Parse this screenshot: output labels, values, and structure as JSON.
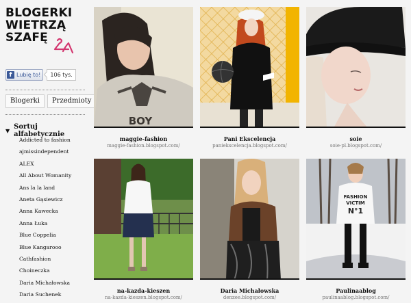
{
  "brand": {
    "logo_line1": "BLOGERKI",
    "logo_line2": "WIETRZĄ",
    "logo_line3": "SZAFĘ",
    "accent": "#d3366f"
  },
  "facebook": {
    "like_label": "Lubię to!",
    "count": "106 tys."
  },
  "tabs": [
    "Blogerki",
    "Przedmioty"
  ],
  "sort": {
    "label": "Sortuj alfabetycznie"
  },
  "blog_list": [
    "Addicted to fashion",
    "ajmissindependent",
    "ALEX",
    "All About Womanity",
    "Ans la la land",
    "Aneta Gąsiewicz",
    "Anna Kawecka",
    "Anna Łuka",
    "Blue Coppelia",
    "Blue Kangarooo",
    "Cathfashion",
    "Choineczka",
    "Daria Michałowska",
    "Daria Suchenek"
  ],
  "cards": [
    {
      "name": "maggie-fashion",
      "url": "maggie-fashion.blogspot.com/",
      "shirt_text": "BOY"
    },
    {
      "name": "Pani Ekscelencja",
      "url": "paniekscelencja.blogspot.com/"
    },
    {
      "name": "soie",
      "url": "soie-pl.blogspot.com/"
    },
    {
      "name": "na-kazda-kieszen",
      "url": "na-kazda-kieszen.blogspot.com/"
    },
    {
      "name": "Daria Michałowska",
      "url": "denzee.blogspot.com/"
    },
    {
      "name": "Paulinaablog",
      "url": "paulinaablog.blogspot.com/",
      "shirt_text_1": "FASHION",
      "shirt_text_2": "VICTIM",
      "shirt_text_3": "N°1"
    }
  ]
}
